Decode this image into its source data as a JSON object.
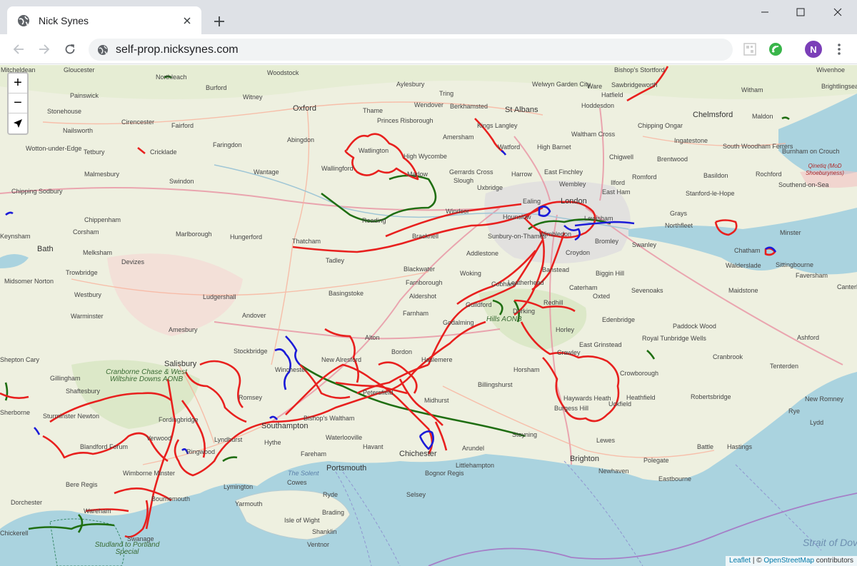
{
  "browser": {
    "tab_title": "Nick Synes",
    "url": "self-prop.nicksynes.com",
    "avatar_initial": "N"
  },
  "map": {
    "controls": {
      "zoom_in": "+",
      "zoom_out": "−"
    },
    "attribution": {
      "leaflet": "Leaflet",
      "separator": " | © ",
      "osm": "OpenStreetMap",
      "suffix": " contributors"
    },
    "route_colors": {
      "red": "#e8201e",
      "green": "#1f6e12",
      "blue": "#1b1bd8"
    },
    "places": [
      {
        "n": "Mitcheldean"
      },
      {
        "n": "Gloucester"
      },
      {
        "n": "Northleach"
      },
      {
        "n": "Woodstock"
      },
      {
        "n": "Aylesbury"
      },
      {
        "n": "Tring"
      },
      {
        "n": "Berkhamsted"
      },
      {
        "n": "Welwyn Garden City"
      },
      {
        "n": "Ware"
      },
      {
        "n": "Sawbridgeworth"
      },
      {
        "n": "Bishop's Stortford"
      },
      {
        "n": "Witham"
      },
      {
        "n": "Brightlingsea"
      },
      {
        "n": "Wivenhoe"
      },
      {
        "n": "Painswick"
      },
      {
        "n": "Burford"
      },
      {
        "n": "Witney"
      },
      {
        "n": "Oxford"
      },
      {
        "n": "Thame"
      },
      {
        "n": "Wendover"
      },
      {
        "n": "St Albans"
      },
      {
        "n": "Hatfield"
      },
      {
        "n": "Hoddesdon"
      },
      {
        "n": "Chelmsford"
      },
      {
        "n": "Maldon"
      },
      {
        "n": "Stonehouse"
      },
      {
        "n": "Cirencester"
      },
      {
        "n": "Princes Risborough"
      },
      {
        "n": "Kings Langley"
      },
      {
        "n": "Nailsworth"
      },
      {
        "n": "Fairford"
      },
      {
        "n": "Waltham Cross"
      },
      {
        "n": "Chipping Ongar"
      },
      {
        "n": "Abingdon"
      },
      {
        "n": "Amersham"
      },
      {
        "n": "Watford"
      },
      {
        "n": "High Barnet"
      },
      {
        "n": "Ingatestone"
      },
      {
        "n": "Wotton-under-Edge"
      },
      {
        "n": "Faringdon"
      },
      {
        "n": "Watlington"
      },
      {
        "n": "High Wycombe"
      },
      {
        "n": "Chigwell"
      },
      {
        "n": "South Woodham Ferrers"
      },
      {
        "n": "Burnham on Crouch"
      },
      {
        "n": "Tetbury"
      },
      {
        "n": "Cricklade"
      },
      {
        "n": "Brentwood"
      },
      {
        "n": "Qinetiq (MoD Shoeburyness)"
      },
      {
        "n": "Malmesbury"
      },
      {
        "n": "Wantage"
      },
      {
        "n": "Wallingford"
      },
      {
        "n": "Gerrards Cross"
      },
      {
        "n": "Harrow"
      },
      {
        "n": "East Finchley"
      },
      {
        "n": "Romford"
      },
      {
        "n": "Basildon"
      },
      {
        "n": "Rochford"
      },
      {
        "n": "Swindon"
      },
      {
        "n": "Marlow"
      },
      {
        "n": "Uxbridge"
      },
      {
        "n": "Wembley"
      },
      {
        "n": "Ilford"
      },
      {
        "n": "Chipping Sodbury"
      },
      {
        "n": "Slough"
      },
      {
        "n": "East Ham"
      },
      {
        "n": "Stanford-le-Hope"
      },
      {
        "n": "Southend-on-Sea"
      },
      {
        "n": "Ealing"
      },
      {
        "n": "London"
      },
      {
        "n": "Windsor"
      },
      {
        "n": "Grays"
      },
      {
        "n": "Chippenham"
      },
      {
        "n": "Hounslow"
      },
      {
        "n": "Lewisham"
      },
      {
        "n": "Marlborough"
      },
      {
        "n": "Reading"
      },
      {
        "n": "Wimbledon"
      },
      {
        "n": "Keynsham"
      },
      {
        "n": "Corsham"
      },
      {
        "n": "Hungerford"
      },
      {
        "n": "Bracknell"
      },
      {
        "n": "Sunbury-on-Thames"
      },
      {
        "n": "Northfleet"
      },
      {
        "n": "Minster"
      },
      {
        "n": "Thatcham"
      },
      {
        "n": "Bromley"
      },
      {
        "n": "Swanley"
      },
      {
        "n": "Bath"
      },
      {
        "n": "Melksham"
      },
      {
        "n": "Devizes"
      },
      {
        "n": "Addlestone"
      },
      {
        "n": "Croydon"
      },
      {
        "n": "Chatham"
      },
      {
        "n": "Tadley"
      },
      {
        "n": "Sittingbourne"
      },
      {
        "n": "Trowbridge"
      },
      {
        "n": "Blackwater"
      },
      {
        "n": "Woking"
      },
      {
        "n": "Cobham"
      },
      {
        "n": "Banstead"
      },
      {
        "n": "Biggin Hill"
      },
      {
        "n": "Walderslade"
      },
      {
        "n": "Faversham"
      },
      {
        "n": "Midsomer Norton"
      },
      {
        "n": "Farnborough"
      },
      {
        "n": "Leatherhead"
      },
      {
        "n": "Westbury"
      },
      {
        "n": "Ludgershall"
      },
      {
        "n": "Basingstoke"
      },
      {
        "n": "Caterham"
      },
      {
        "n": "Sevenoaks"
      },
      {
        "n": "Maidstone"
      },
      {
        "n": "Canterbury"
      },
      {
        "n": "Aldershot"
      },
      {
        "n": "Oxted"
      },
      {
        "n": "Guildford"
      },
      {
        "n": "Dorking"
      },
      {
        "n": "Redhill"
      },
      {
        "n": "Warminster"
      },
      {
        "n": "Andover"
      },
      {
        "n": "Farnham"
      },
      {
        "n": "Edenbridge"
      },
      {
        "n": "Hills AONB"
      },
      {
        "n": "Amesbury"
      },
      {
        "n": "Godalming"
      },
      {
        "n": "Paddock Wood"
      },
      {
        "n": "Horley"
      },
      {
        "n": "Alton"
      },
      {
        "n": "Royal Tunbridge Wells"
      },
      {
        "n": "Ashford"
      },
      {
        "n": "Stockbridge"
      },
      {
        "n": "East Grinstead"
      },
      {
        "n": "Bordon"
      },
      {
        "n": "Crawley"
      },
      {
        "n": "Shepton Cary"
      },
      {
        "n": "Salisbury"
      },
      {
        "n": "New Alresford"
      },
      {
        "n": "Haslemere"
      },
      {
        "n": "Cranbrook"
      },
      {
        "n": "Tenterden"
      },
      {
        "n": "Gillingham"
      },
      {
        "n": "Winchester"
      },
      {
        "n": "Horsham"
      },
      {
        "n": "Crowborough"
      },
      {
        "n": "Cranborne Chase & West Wiltshire Downs AONB"
      },
      {
        "n": "Shaftesbury"
      },
      {
        "n": "Romsey"
      },
      {
        "n": "Petersfield"
      },
      {
        "n": "Billingshurst"
      },
      {
        "n": "Haywards Heath"
      },
      {
        "n": "Heathfield"
      },
      {
        "n": "Robertsbridge"
      },
      {
        "n": "New Romney"
      },
      {
        "n": "Midhurst"
      },
      {
        "n": "Uckfield"
      },
      {
        "n": "Sherborne"
      },
      {
        "n": "Sturminster Newton"
      },
      {
        "n": "Fordingbridge"
      },
      {
        "n": "Bishop's Waltham"
      },
      {
        "n": "Burgess Hill"
      },
      {
        "n": "Rye"
      },
      {
        "n": "Lydd"
      },
      {
        "n": "Verwood"
      },
      {
        "n": "Southampton"
      },
      {
        "n": "Steyning"
      },
      {
        "n": "Battle"
      },
      {
        "n": "Blandford Forum"
      },
      {
        "n": "Lyndhurst"
      },
      {
        "n": "Waterlooville"
      },
      {
        "n": "Lewes"
      },
      {
        "n": "Ringwood"
      },
      {
        "n": "Hythe"
      },
      {
        "n": "Fareham"
      },
      {
        "n": "Havant"
      },
      {
        "n": "Chichester"
      },
      {
        "n": "Arundel"
      },
      {
        "n": "Brighton"
      },
      {
        "n": "Hastings"
      },
      {
        "n": "Wimborne Minster"
      },
      {
        "n": "Portsmouth"
      },
      {
        "n": "Littlehampton"
      },
      {
        "n": "Polegate"
      },
      {
        "n": "Newhaven"
      },
      {
        "n": "Bere Regis"
      },
      {
        "n": "The Solent"
      },
      {
        "n": "Bognor Regis"
      },
      {
        "n": "Eastbourne"
      },
      {
        "n": "Lymington"
      },
      {
        "n": "Cowes"
      },
      {
        "n": "Bournemouth"
      },
      {
        "n": "Ryde"
      },
      {
        "n": "Dorchester"
      },
      {
        "n": "Yarmouth"
      },
      {
        "n": "Selsey"
      },
      {
        "n": "Wareham"
      },
      {
        "n": "Brading"
      },
      {
        "n": "Isle of Wight"
      },
      {
        "n": "Swanage"
      },
      {
        "n": "Shanklin"
      },
      {
        "n": "Chickerell"
      },
      {
        "n": "Ventnor"
      },
      {
        "n": "Studland to Portland Special"
      },
      {
        "n": "Strait of Dover"
      }
    ]
  }
}
